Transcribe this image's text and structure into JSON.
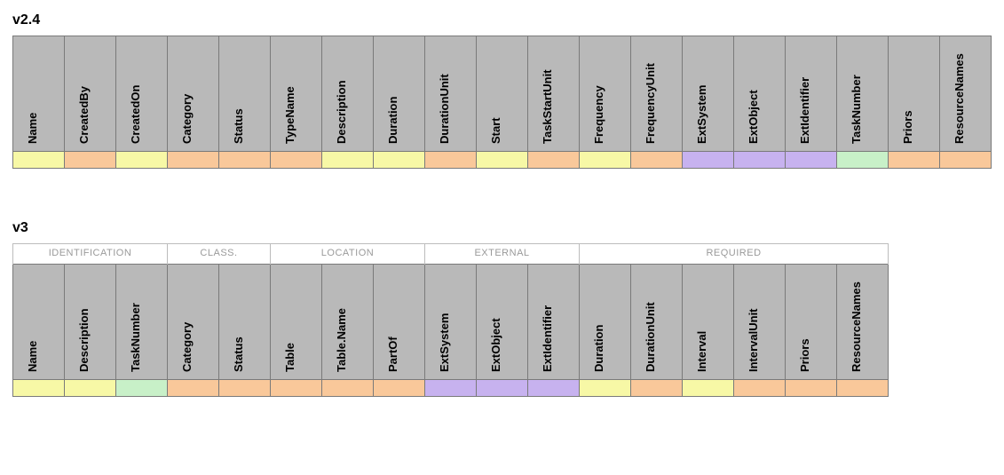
{
  "colors": {
    "header_bg": "#b9b9b9",
    "yellow": "#f7f8a6",
    "orange": "#f9c89a",
    "purple": "#c7b2ef",
    "green": "#c8f0c8"
  },
  "v24": {
    "title": "v2.4",
    "columns": [
      {
        "label": "Name",
        "color": "yellow"
      },
      {
        "label": "CreatedBy",
        "color": "orange"
      },
      {
        "label": "CreatedOn",
        "color": "yellow"
      },
      {
        "label": "Category",
        "color": "orange"
      },
      {
        "label": "Status",
        "color": "orange"
      },
      {
        "label": "TypeName",
        "color": "orange"
      },
      {
        "label": "Description",
        "color": "yellow"
      },
      {
        "label": "Duration",
        "color": "yellow"
      },
      {
        "label": "DurationUnit",
        "color": "orange"
      },
      {
        "label": "Start",
        "color": "yellow"
      },
      {
        "label": "TaskStartUnit",
        "color": "orange"
      },
      {
        "label": "Frequency",
        "color": "yellow"
      },
      {
        "label": "FrequencyUnit",
        "color": "orange"
      },
      {
        "label": "ExtSystem",
        "color": "purple"
      },
      {
        "label": "ExtObject",
        "color": "purple"
      },
      {
        "label": "ExtIdentifier",
        "color": "purple"
      },
      {
        "label": "TaskNumber",
        "color": "green"
      },
      {
        "label": "Priors",
        "color": "orange"
      },
      {
        "label": "ResourceNames",
        "color": "orange"
      }
    ]
  },
  "v3": {
    "title": "v3",
    "groups": [
      {
        "label": "IDENTIFICATION",
        "span": 3
      },
      {
        "label": "CLASS.",
        "span": 2
      },
      {
        "label": "LOCATION",
        "span": 3
      },
      {
        "label": "EXTERNAL",
        "span": 3
      },
      {
        "label": "REQUIRED",
        "span": 6
      }
    ],
    "columns": [
      {
        "label": "Name",
        "color": "yellow"
      },
      {
        "label": "Description",
        "color": "yellow"
      },
      {
        "label": "TaskNumber",
        "color": "green"
      },
      {
        "label": "Category",
        "color": "orange"
      },
      {
        "label": "Status",
        "color": "orange"
      },
      {
        "label": "Table",
        "color": "orange"
      },
      {
        "label": "Table.Name",
        "color": "orange"
      },
      {
        "label": "PartOf",
        "color": "orange"
      },
      {
        "label": "ExtSystem",
        "color": "purple"
      },
      {
        "label": "ExtObject",
        "color": "purple"
      },
      {
        "label": "ExtIdentifier",
        "color": "purple"
      },
      {
        "label": "Duration",
        "color": "yellow"
      },
      {
        "label": "DurationUnit",
        "color": "orange"
      },
      {
        "label": "Interval",
        "color": "yellow"
      },
      {
        "label": "IntervalUnit",
        "color": "orange"
      },
      {
        "label": "Priors",
        "color": "orange"
      },
      {
        "label": "ResourceNames",
        "color": "orange"
      }
    ]
  }
}
